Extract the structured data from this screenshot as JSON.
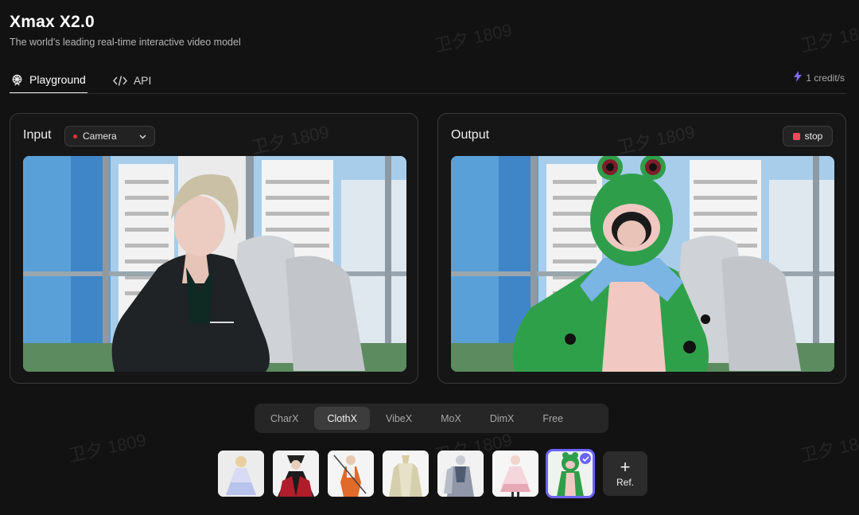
{
  "app": {
    "title": "Xmax X2.0",
    "subtitle": "The world's leading real-time interactive video model"
  },
  "tabs": [
    {
      "label": "Playground",
      "icon": "ferris-wheel-icon",
      "active": true
    },
    {
      "label": "API",
      "icon": "code-icon",
      "active": false
    }
  ],
  "credit": {
    "text": "1 credit/s",
    "icon": "lightning-icon",
    "color": "#7b6cf6"
  },
  "input": {
    "label": "Input",
    "source": "Camera",
    "source_dot_color": "#e33333"
  },
  "output": {
    "label": "Output",
    "stop_label": "stop",
    "stop_color": "#f04a5a"
  },
  "modes": [
    {
      "label": "CharX",
      "active": false
    },
    {
      "label": "ClothX",
      "active": true
    },
    {
      "label": "VibeX",
      "active": false
    },
    {
      "label": "MoX",
      "active": false
    },
    {
      "label": "DimX",
      "active": false
    },
    {
      "label": "Free",
      "active": false
    }
  ],
  "thumbnails": [
    {
      "name": "white-lolita-dress",
      "selected": false
    },
    {
      "name": "red-black-costume",
      "selected": false
    },
    {
      "name": "orange-warrior-costume",
      "selected": false
    },
    {
      "name": "cream-robe-costume",
      "selected": false
    },
    {
      "name": "silver-armor-costume",
      "selected": false
    },
    {
      "name": "pink-maid-dress",
      "selected": false
    },
    {
      "name": "frog-onesie",
      "selected": true
    }
  ],
  "ref_button": {
    "label": "Ref.",
    "icon": "plus-icon"
  },
  "watermark": "卫夕 1809",
  "accent": "#6c63ff"
}
